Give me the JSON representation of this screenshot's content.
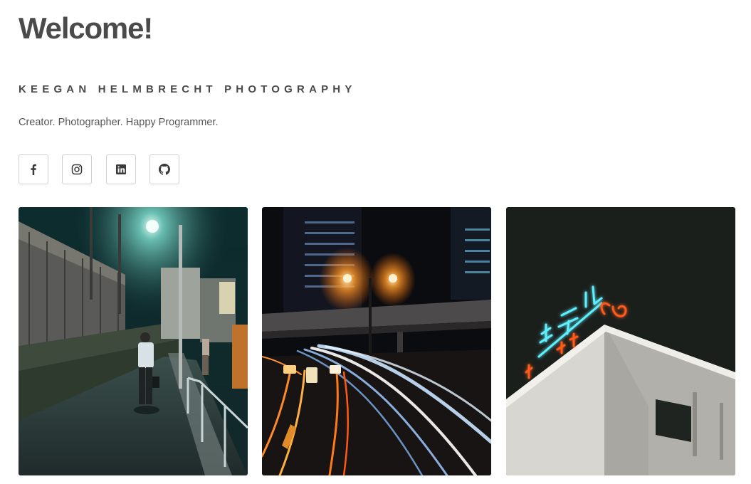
{
  "header": {
    "title": "Welcome!",
    "subtitle": "KEEGAN HELMBRECHT PHOTOGRAPHY",
    "tagline": "Creator. Photographer. Happy Programmer."
  },
  "socials": [
    {
      "icon": "facebook-icon",
      "label": "Facebook"
    },
    {
      "icon": "instagram-icon",
      "label": "Instagram"
    },
    {
      "icon": "linkedin-icon",
      "label": "LinkedIn"
    },
    {
      "icon": "github-icon",
      "label": "GitHub"
    }
  ],
  "gallery": {
    "photos": [
      {
        "subject": "night alley with man walking under street lamp"
      },
      {
        "subject": "night highway with light trails"
      },
      {
        "subject": "neon hotel sign on building corner"
      }
    ]
  },
  "colors": {
    "text": "#4a4a4a",
    "border": "#cfcfcf",
    "neon_cyan": "#5ff0ff",
    "neon_orange": "#ff5a1e"
  }
}
